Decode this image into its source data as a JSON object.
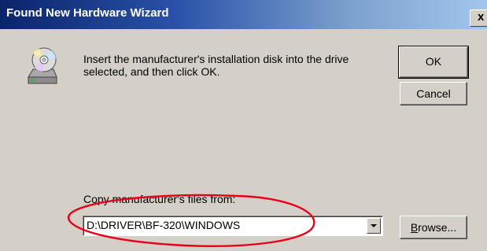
{
  "window": {
    "title": "Found New Hardware Wizard",
    "close_glyph": "x"
  },
  "dialog": {
    "icon": "cd-disk-icon",
    "message": "Insert the manufacturer's installation disk into the drive selected, and then click OK.",
    "ok_label": "OK",
    "cancel_label": "Cancel",
    "copy_label": "Copy manufacturer's files from:",
    "path_value": "D:\\DRIVER\\BF-320\\WINDOWS",
    "browse_label_prefix": "B",
    "browse_label_rest": "rowse..."
  },
  "annotation": {
    "color": "#e8001c",
    "shape": "ellipse"
  }
}
